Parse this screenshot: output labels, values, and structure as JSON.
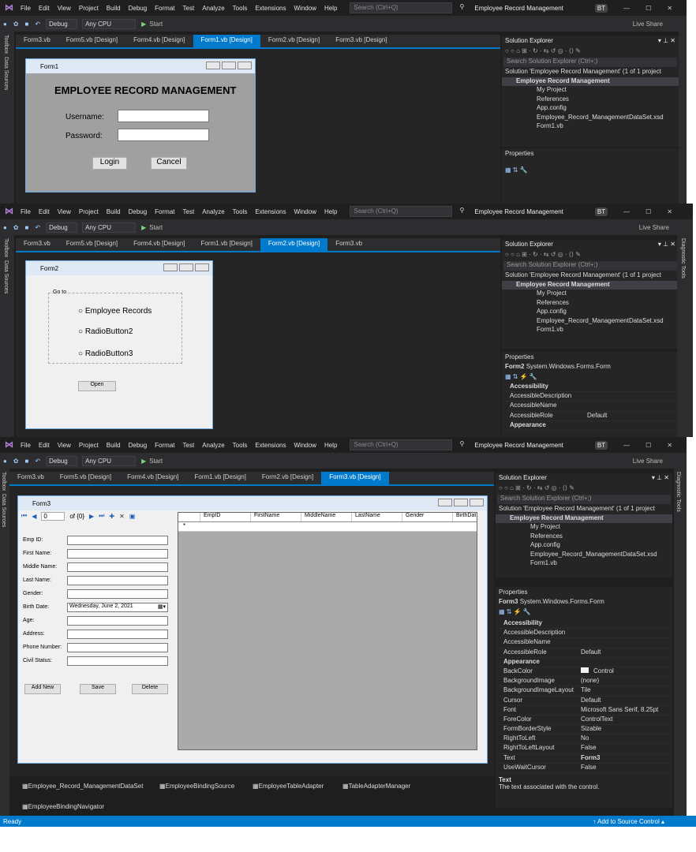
{
  "menu": [
    "File",
    "Edit",
    "View",
    "Project",
    "Build",
    "Debug",
    "Format",
    "Test",
    "Analyze",
    "Tools",
    "Extensions",
    "Window",
    "Help"
  ],
  "search_placeholder": "Search (Ctrl+Q)",
  "project_name": "Employee Record Management",
  "user_initials": "BT",
  "live_share": "Live Share",
  "toolbar": {
    "config": "Debug",
    "platform": "Any CPU",
    "start": "Start"
  },
  "left_strip": [
    "Toolbox",
    "Data Sources"
  ],
  "right_strip": "Diagnostic Tools",
  "tabs": [
    "Form3.vb",
    "Form5.vb [Design]",
    "Form4.vb [Design]",
    "Form1.vb [Design]",
    "Form2.vb [Design]",
    "Form3.vb [Design]"
  ],
  "shot1": {
    "active_tab": 3,
    "form": {
      "title": "Form1",
      "heading": "EMPLOYEE RECORD MANAGEMENT",
      "username_label": "Username:",
      "password_label": "Password:",
      "login": "Login",
      "cancel": "Cancel"
    }
  },
  "shot2": {
    "active_tab": 4,
    "form": {
      "title": "Form2",
      "group": "Go to",
      "radio1": "Employee Records",
      "radio2": "RadioButton2",
      "radio3": "RadioButton3",
      "open": "Open"
    }
  },
  "shot3": {
    "active_tab": 5,
    "form": {
      "title": "Form3",
      "nav_position": "0",
      "nav_count": "of {0}",
      "fields": [
        "Emp ID:",
        "First Name:",
        "Middle Name:",
        "Last Name:",
        "Gender:",
        "Birth Date:",
        "Age:",
        "Address:",
        "Phone Number:",
        "Civil Status:"
      ],
      "birthdate": "Wednesday,     June    2, 2021",
      "add_new": "Add New",
      "save": "Save",
      "delete": "Delete",
      "grid_columns": [
        "EmpID",
        "FirstName",
        "MiddleName",
        "LastName",
        "Gender",
        "BirthDat"
      ]
    },
    "components": [
      "Employee_Record_ManagementDataSet",
      "EmployeeBindingSource",
      "EmployeeTableAdapter",
      "TableAdapterManager",
      "EmployeeBindingNavigator"
    ]
  },
  "solution_explorer": {
    "title": "Solution Explorer",
    "search": "Search Solution Explorer (Ctrl+;)",
    "items": [
      "Solution 'Employee Record Management' (1 of 1 project",
      "Employee Record Management",
      "My Project",
      "References",
      "App.config",
      "Employee_Record_ManagementDataSet.xsd",
      "Form1.vb"
    ]
  },
  "properties": {
    "title": "Properties",
    "object2": "Form2",
    "object3": "Form3",
    "type": "System.Windows.Forms.Form",
    "rows": [
      {
        "k": "Accessibility",
        "v": "",
        "cat": true
      },
      {
        "k": "AccessibleDescription",
        "v": ""
      },
      {
        "k": "AccessibleName",
        "v": ""
      },
      {
        "k": "AccessibleRole",
        "v": "Default"
      },
      {
        "k": "Appearance",
        "v": "",
        "cat": true
      },
      {
        "k": "BackColor",
        "v": "Control"
      },
      {
        "k": "BackgroundImage",
        "v": "(none)"
      },
      {
        "k": "BackgroundImageLayout",
        "v": "Tile"
      },
      {
        "k": "Cursor",
        "v": "Default"
      },
      {
        "k": "Font",
        "v": "Microsoft Sans Serif, 8.25pt"
      },
      {
        "k": "ForeColor",
        "v": "ControlText"
      },
      {
        "k": "FormBorderStyle",
        "v": "Sizable"
      },
      {
        "k": "RightToLeft",
        "v": "No"
      },
      {
        "k": "RightToLeftLayout",
        "v": "False"
      },
      {
        "k": "Text",
        "v": "Form3"
      },
      {
        "k": "UseWaitCursor",
        "v": "False"
      }
    ],
    "desc_title": "Text",
    "desc": "The text associated with the control."
  },
  "status": {
    "ready": "Ready",
    "source_control": "Add to Source Control"
  }
}
